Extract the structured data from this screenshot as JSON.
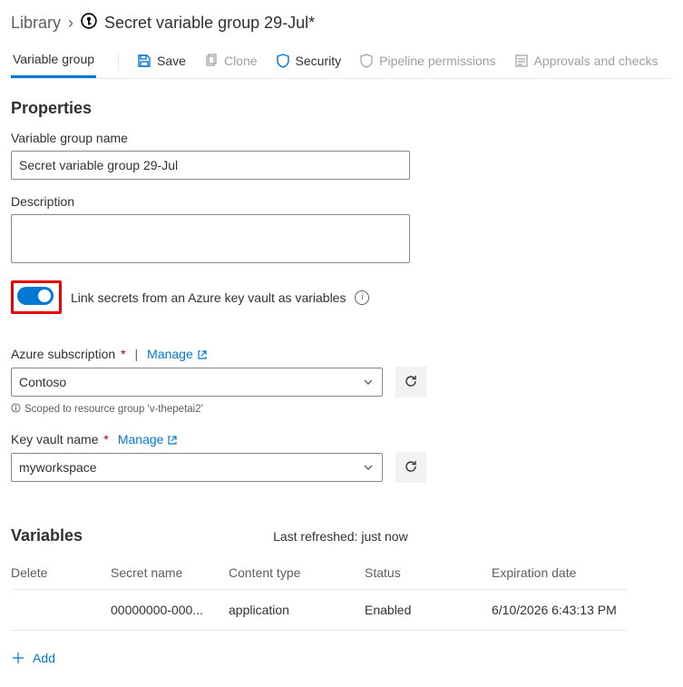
{
  "breadcrumb": {
    "library": "Library",
    "title": "Secret variable group 29-Jul*"
  },
  "tab": {
    "label": "Variable group"
  },
  "toolbar": {
    "save": "Save",
    "clone": "Clone",
    "security": "Security",
    "pipeline_permissions": "Pipeline permissions",
    "approvals": "Approvals and checks"
  },
  "properties": {
    "heading": "Properties",
    "name_label": "Variable group name",
    "name_value": "Secret variable group 29-Jul",
    "description_label": "Description",
    "description_value": "",
    "link_label": "Link secrets from an Azure key vault as variables"
  },
  "subscription": {
    "label": "Azure subscription",
    "manage": "Manage",
    "value": "Contoso",
    "hint": "Scoped to resource group 'v-thepetai2'"
  },
  "keyvault": {
    "label": "Key vault name",
    "manage": "Manage",
    "value": "myworkspace"
  },
  "variables": {
    "heading": "Variables",
    "last_refreshed": "Last refreshed: just now",
    "columns": {
      "delete": "Delete",
      "secret_name": "Secret name",
      "content_type": "Content type",
      "status": "Status",
      "expiration": "Expiration date"
    },
    "rows": [
      {
        "secret_name": "00000000-000...",
        "content_type": "application",
        "status": "Enabled",
        "expiration": "6/10/2026 6:43:13 PM"
      }
    ],
    "add": "Add"
  }
}
